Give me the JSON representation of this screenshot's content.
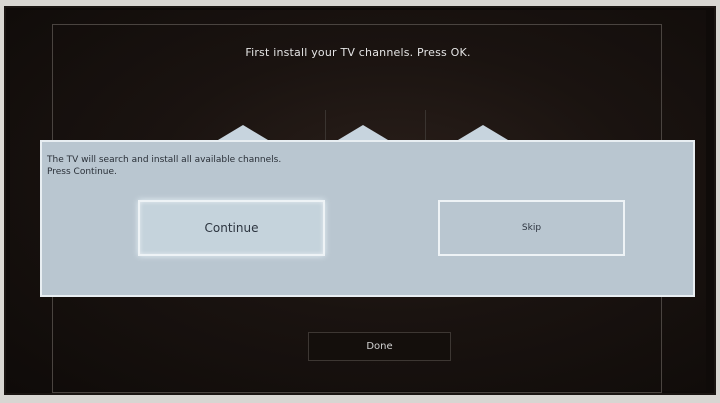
{
  "screen": {
    "header": "First install your TV channels. Press OK."
  },
  "dialog": {
    "message_line1": "The TV will search and install all available channels.",
    "message_line2": "Press Continue.",
    "continue_label": "Continue",
    "skip_label": "Skip"
  },
  "footer": {
    "done_label": "Done"
  },
  "colors": {
    "screen_background": "#1a1310",
    "dialog_background": "#b9c6d0",
    "dialog_border": "#e8eef2",
    "text_light": "#e4e4e4",
    "text_dark": "#2d3540"
  }
}
